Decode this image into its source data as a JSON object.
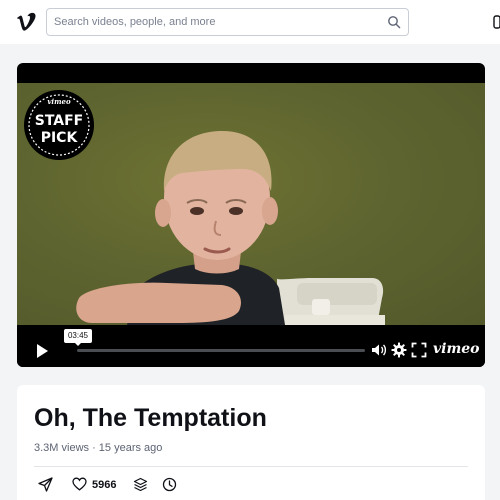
{
  "header": {
    "logo_icon": "vimeo-logo-icon",
    "search": {
      "placeholder": "Search videos, people, and more",
      "icon": "search-icon"
    }
  },
  "player": {
    "badge": {
      "top_text": "vimeo",
      "line1": "STAFF",
      "line2": "PICK"
    },
    "timestamp": "03:45",
    "brand": "vimeo",
    "icons": [
      "play-icon",
      "volume-icon",
      "settings-icon",
      "fullscreen-icon"
    ],
    "colors": {
      "background": "#000000",
      "video_tint": "#5f6530"
    }
  },
  "video": {
    "title": "Oh, The Temptation",
    "meta": "3.3M views · 15 years ago",
    "actions": {
      "share_icon": "share-icon",
      "like_icon": "heart-icon",
      "likes": "5966",
      "collections_icon": "layers-icon",
      "watch_later_icon": "clock-icon"
    }
  }
}
